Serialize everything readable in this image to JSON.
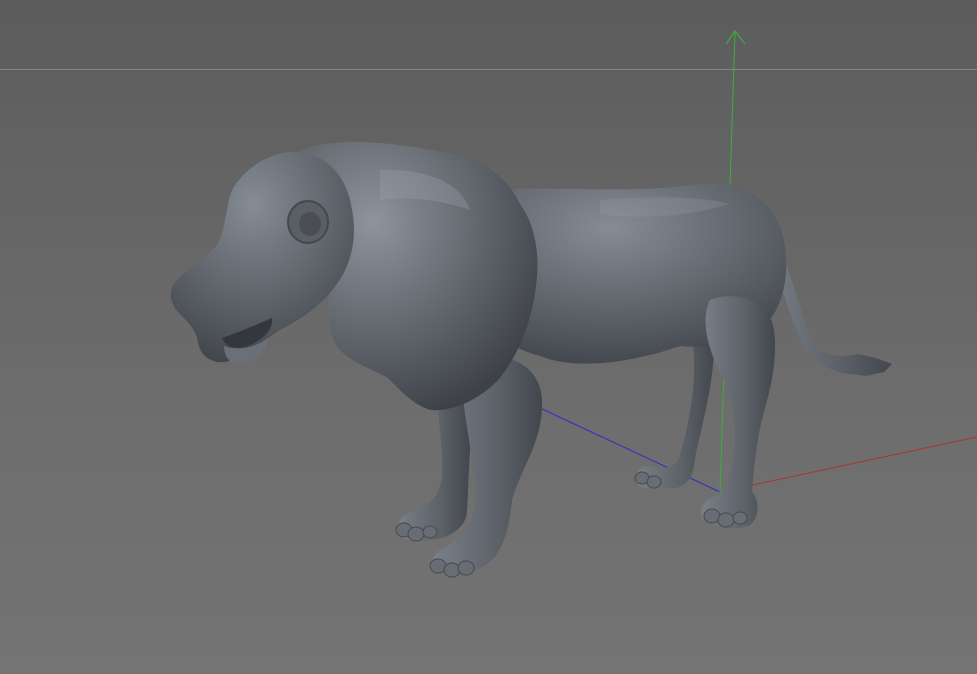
{
  "viewport": {
    "background_color": "#646464",
    "horizon_line_color": "#8c8c8c"
  },
  "model": {
    "name": "lion",
    "base_color": "#5f646b",
    "highlight_color": "#8b9199",
    "shadow_color": "#3c4046"
  },
  "axes": {
    "x_axis_color": "#b03030",
    "y_axis_color": "#3cae3c",
    "z_axis_color": "#3030c0"
  }
}
